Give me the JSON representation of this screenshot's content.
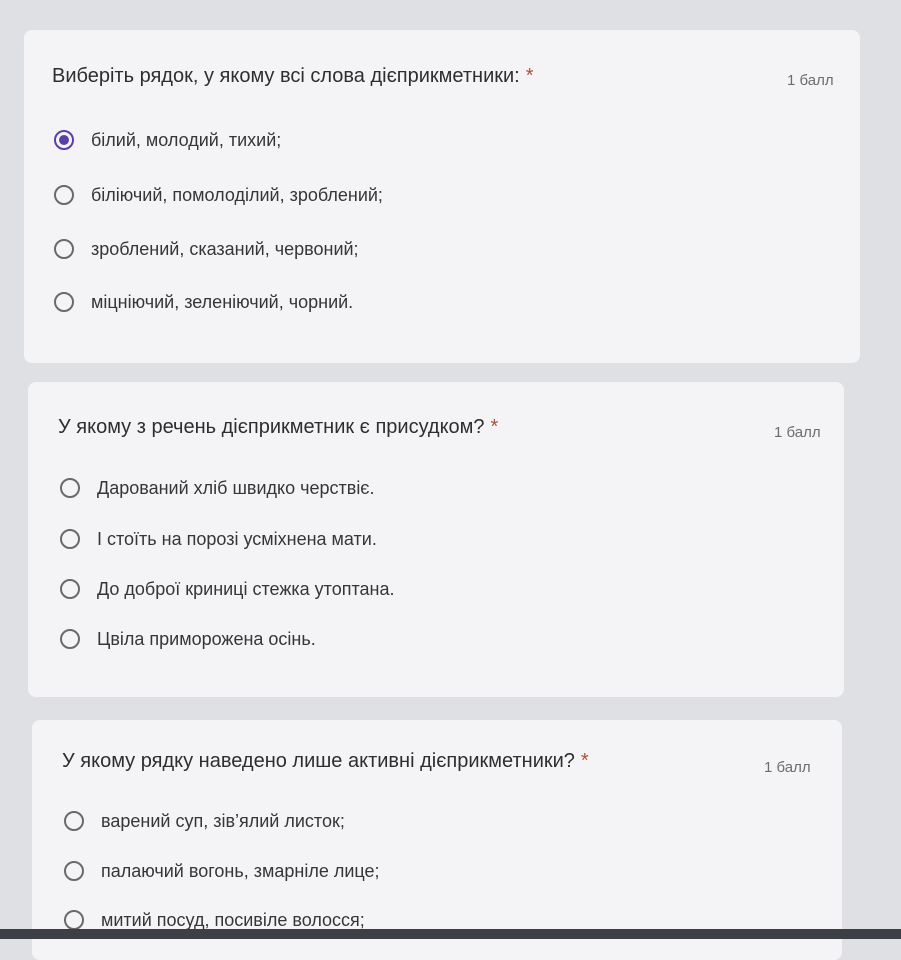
{
  "questions": [
    {
      "title": "Виберіть рядок, у якому всі слова дієприкметники:",
      "required_mark": "*",
      "points": "1 балл",
      "options": [
        {
          "label": "білий, молодий, тихий;",
          "selected": true
        },
        {
          "label": "біліючий, помолоділий, зроблений;",
          "selected": false
        },
        {
          "label": "зроблений, сказаний, червоний;",
          "selected": false
        },
        {
          "label": "міцніючий, зеленіючий, чорний.",
          "selected": false
        }
      ]
    },
    {
      "title": "У якому з речень дієприкметник є присудком?",
      "required_mark": "*",
      "points": "1 балл",
      "options": [
        {
          "label": "Дарований хліб швидко черствіє.",
          "selected": false
        },
        {
          "label": "І стоїть на порозі усміхнена мати.",
          "selected": false
        },
        {
          "label": "До доброї криниці стежка утоптана.",
          "selected": false
        },
        {
          "label": "Цвіла приморожена осінь.",
          "selected": false
        }
      ]
    },
    {
      "title": "У якому рядку наведено лише активні дієприкметники?",
      "required_mark": "*",
      "points": "1 балл",
      "options": [
        {
          "label": "варений суп, зів’ялий листок;",
          "selected": false
        },
        {
          "label": "палаючий вогонь, змарніле лице;",
          "selected": false
        },
        {
          "label": "митий посуд, посивіле волосся;",
          "selected": false
        }
      ]
    }
  ],
  "colors": {
    "accent": "#5a3fa8",
    "required": "#b0503c"
  }
}
